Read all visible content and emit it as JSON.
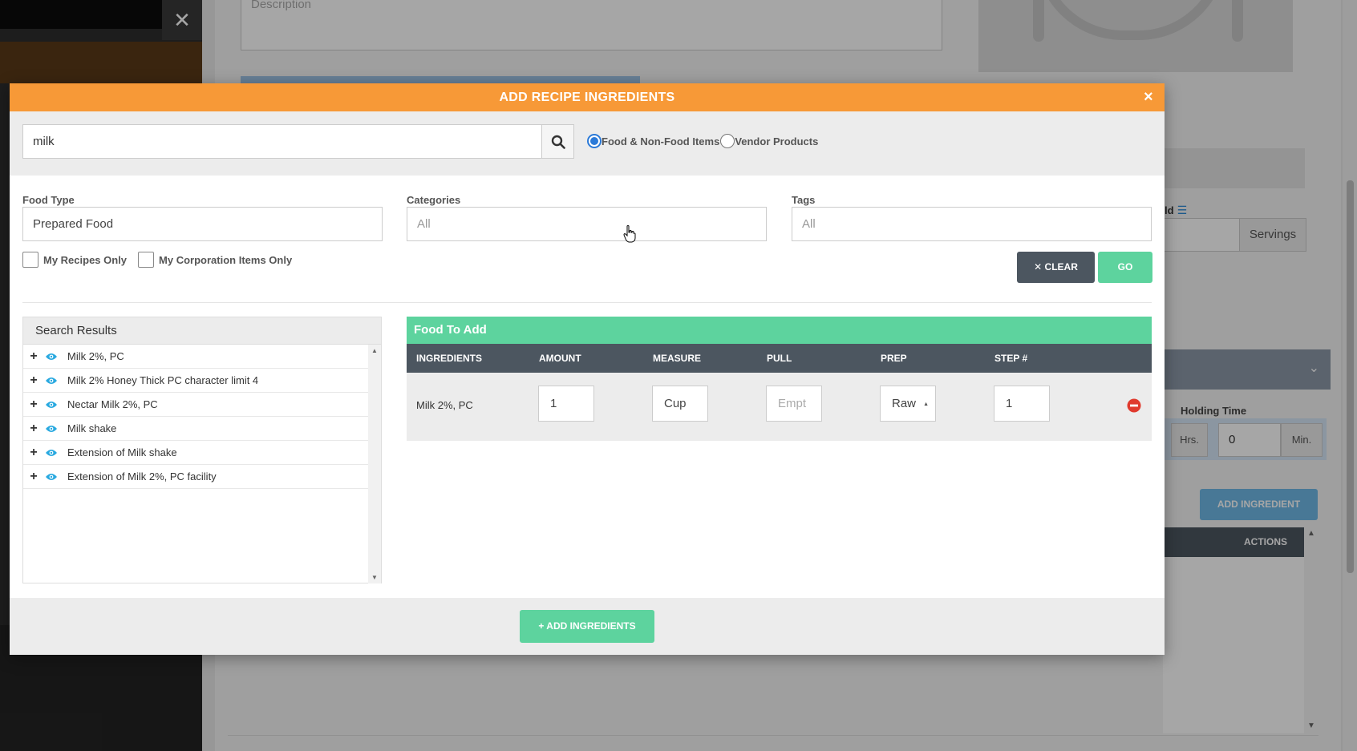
{
  "background": {
    "description_placeholder": "Description",
    "servings_label": "Servings",
    "id_label_fragment": "ld",
    "holding_time_label": "Holding Time",
    "hrs_label": "Hrs.",
    "min_value": "0",
    "min_label": "Min.",
    "add_ingredient_label": "ADD INGREDIENT",
    "actions_header": "ACTIONS"
  },
  "modal": {
    "title": "ADD RECIPE INGREDIENTS",
    "close_glyph": "×",
    "search": {
      "value": "milk",
      "placeholder": ""
    },
    "radio_options": [
      {
        "label": "Food & Non-Food Items",
        "selected": true
      },
      {
        "label": "Vendor Products",
        "selected": false
      }
    ],
    "filters": {
      "food_type": {
        "label": "Food Type",
        "value": "Prepared Food"
      },
      "categories": {
        "label": "Categories",
        "value": "All"
      },
      "tags": {
        "label": "Tags",
        "value": "All"
      }
    },
    "checkboxes": {
      "my_recipes": "My Recipes Only",
      "my_corporation": "My Corporation Items Only"
    },
    "buttons": {
      "clear": "CLEAR",
      "clear_glyph": "✕",
      "go": "GO",
      "add_ingredients": "ADD INGREDIENTS",
      "add_glyph": "+"
    },
    "results": {
      "title": "Search Results",
      "items": [
        "Milk 2%, PC",
        "Milk 2% Honey Thick PC character limit 4",
        "Nectar Milk 2%, PC",
        "Milk shake",
        "Extension of Milk shake",
        "Extension of Milk 2%, PC facility"
      ]
    },
    "food_to_add": {
      "title": "Food To Add",
      "columns": [
        "INGREDIENTS",
        "AMOUNT",
        "MEASURE",
        "PULL",
        "PREP",
        "STEP #"
      ],
      "rows": [
        {
          "ingredient": "Milk 2%, PC",
          "amount": "1",
          "measure": "Cup",
          "pull": "Empt",
          "prep": "Raw",
          "step": "1"
        }
      ]
    }
  },
  "colors": {
    "header": "#f79937",
    "green": "#5dd39e",
    "dark": "#4c5660",
    "blue_radio": "#2b7ad8",
    "remove_red": "#e03a2e"
  }
}
